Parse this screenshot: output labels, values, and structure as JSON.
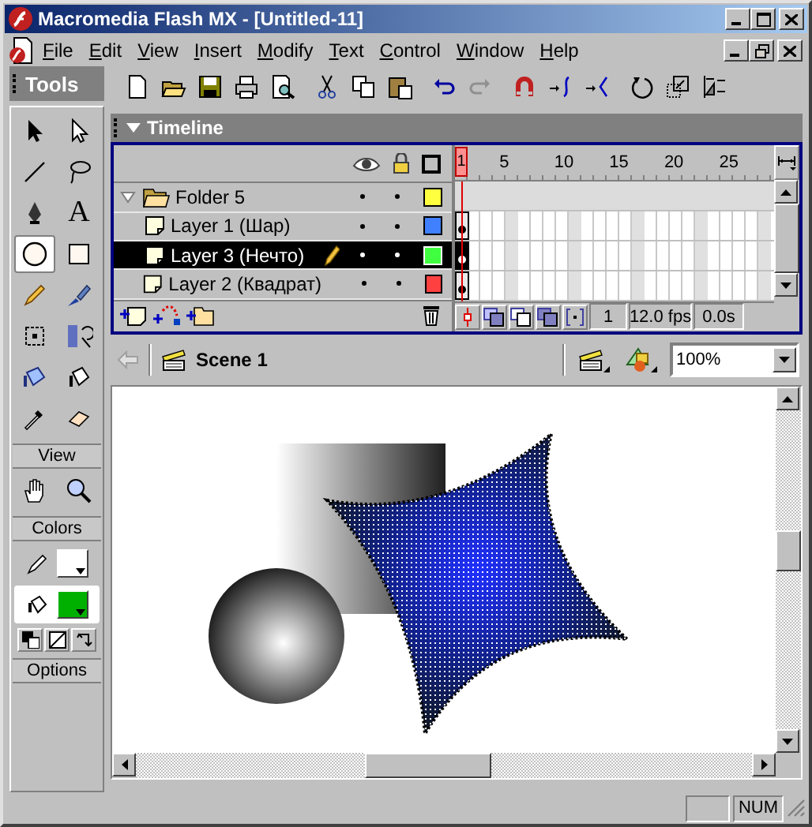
{
  "window": {
    "title": "Macromedia Flash MX - [Untitled-11]"
  },
  "menu": [
    "File",
    "Edit",
    "View",
    "Insert",
    "Modify",
    "Text",
    "Control",
    "Window",
    "Help"
  ],
  "tools": {
    "title": "Tools",
    "items": [
      {
        "kind": "arrow",
        "selected": false
      },
      {
        "kind": "subselect",
        "selected": false
      },
      {
        "kind": "line",
        "selected": false
      },
      {
        "kind": "lasso",
        "selected": false
      },
      {
        "kind": "pen",
        "selected": false
      },
      {
        "kind": "text",
        "selected": false,
        "glyph": "A"
      },
      {
        "kind": "oval",
        "selected": true
      },
      {
        "kind": "rect",
        "selected": false
      },
      {
        "kind": "pencil",
        "selected": false
      },
      {
        "kind": "brush",
        "selected": false
      },
      {
        "kind": "transform",
        "selected": false
      },
      {
        "kind": "fill-transform",
        "selected": false
      },
      {
        "kind": "ink-bottle",
        "selected": false
      },
      {
        "kind": "paint-bucket",
        "selected": false
      },
      {
        "kind": "eyedropper",
        "selected": false
      },
      {
        "kind": "eraser",
        "selected": false
      }
    ]
  },
  "view": {
    "label": "View",
    "items": [
      {
        "kind": "hand",
        "selected": false
      },
      {
        "kind": "zoom",
        "selected": false
      }
    ]
  },
  "colors": {
    "label": "Colors",
    "items": [
      {
        "kind": "stroke",
        "selected": false,
        "color": "#ffffff"
      },
      {
        "kind": "fill",
        "selected": true,
        "color": "#00b000"
      }
    ]
  },
  "options": {
    "label": "Options"
  },
  "timeline": {
    "title": "Timeline",
    "layers": [
      {
        "kind": "folder",
        "name": "Folder 5",
        "expanded": true,
        "selected": false,
        "color": "#ffff40",
        "children": [
          {
            "kind": "layer",
            "name": "Layer 1 (Шар)",
            "selected": false,
            "editing": false,
            "color": "#4080ff"
          },
          {
            "kind": "layer",
            "name": "Layer 3 (Нечто)",
            "selected": true,
            "editing": true,
            "color": "#40ff40"
          },
          {
            "kind": "layer",
            "name": "Layer 2 (Квадрат)",
            "selected": false,
            "editing": false,
            "color": "#ff4040"
          }
        ]
      }
    ],
    "ruler": [
      "1",
      "5",
      "10",
      "15",
      "20",
      "25"
    ],
    "current_frame": "1",
    "frame_rate": "12.0 fps",
    "elapsed": "0.0s"
  },
  "scene": {
    "name": "Scene 1",
    "zoom": "100%"
  },
  "status_bar": {
    "num": "NUM"
  }
}
